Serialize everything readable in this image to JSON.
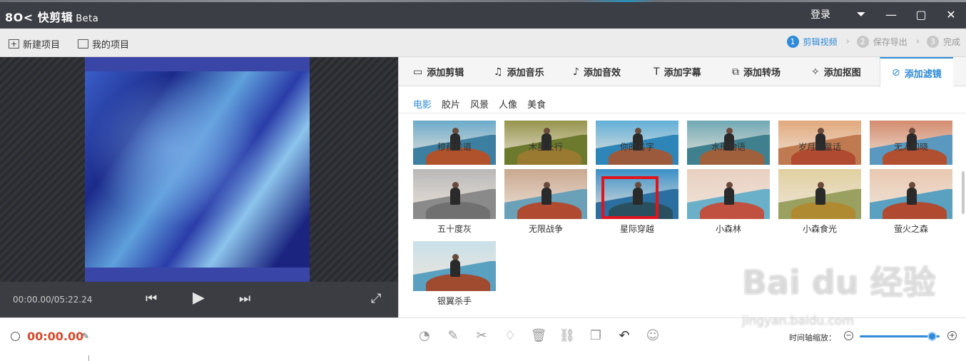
{
  "app": {
    "logo": "8O<",
    "name": "快剪辑",
    "beta": "Beta"
  },
  "titlebar": {
    "login": "登录"
  },
  "toolbar": {
    "new_project": "新建项目",
    "my_projects": "我的项目"
  },
  "steps": [
    {
      "num": "1",
      "label": "剪辑视频"
    },
    {
      "num": "2",
      "label": "保存导出"
    },
    {
      "num": "3",
      "label": "完成"
    }
  ],
  "player": {
    "timecode": "00:00.00/05:22.24"
  },
  "tabs": [
    "添加剪辑",
    "添加音乐",
    "添加音效",
    "添加字幕",
    "添加转场",
    "添加抠图",
    "添加滤镜"
  ],
  "categories": [
    "电影",
    "胶片",
    "风景",
    "人像",
    "美食"
  ],
  "filters": {
    "row1": [
      "穆赫兰道",
      "木星上行",
      "你的名字",
      "水形物语",
      "岁月的童话",
      "无人知晓"
    ],
    "row2": [
      "五十度灰",
      "无限战争",
      "星际穿越",
      "小森林",
      "小森食光",
      "萤火之森"
    ],
    "row3": [
      "银翼杀手"
    ]
  },
  "bottom": {
    "time": "00:00.00",
    "zoom_label": "时间轴缩放：",
    "zoom_level": 0.9
  },
  "watermark": {
    "brand": "Bai du 经验",
    "url": "jingyan.baidu.com"
  },
  "colors": {
    "accent": "#2f8ad8",
    "time": "#d9472b",
    "highlight": "#e0141e"
  }
}
